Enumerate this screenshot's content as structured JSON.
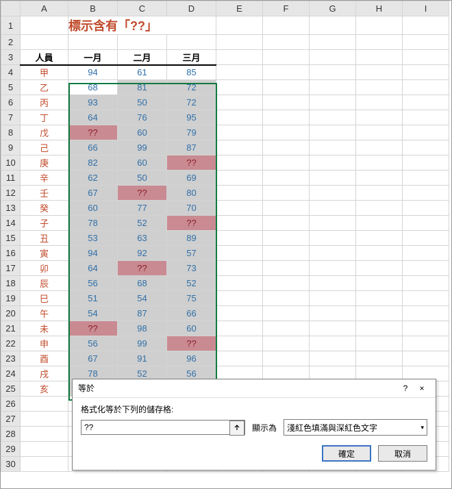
{
  "title": "標示含有「??」",
  "columns": [
    "A",
    "B",
    "C",
    "D",
    "E",
    "F",
    "G",
    "H",
    "I"
  ],
  "headers": {
    "person": "人員",
    "m1": "一月",
    "m2": "二月",
    "m3": "三月"
  },
  "rows": [
    {
      "r": 4,
      "n": "甲",
      "v": [
        "94",
        "61",
        "85"
      ]
    },
    {
      "r": 5,
      "n": "乙",
      "v": [
        "68",
        "81",
        "72"
      ]
    },
    {
      "r": 6,
      "n": "丙",
      "v": [
        "93",
        "50",
        "72"
      ]
    },
    {
      "r": 7,
      "n": "丁",
      "v": [
        "64",
        "76",
        "95"
      ]
    },
    {
      "r": 8,
      "n": "戊",
      "v": [
        "??",
        "60",
        "79"
      ]
    },
    {
      "r": 9,
      "n": "己",
      "v": [
        "66",
        "99",
        "87"
      ]
    },
    {
      "r": 10,
      "n": "庚",
      "v": [
        "82",
        "60",
        "??"
      ]
    },
    {
      "r": 11,
      "n": "辛",
      "v": [
        "62",
        "50",
        "69"
      ]
    },
    {
      "r": 12,
      "n": "壬",
      "v": [
        "67",
        "??",
        "80"
      ]
    },
    {
      "r": 13,
      "n": "癸",
      "v": [
        "60",
        "77",
        "70"
      ]
    },
    {
      "r": 14,
      "n": "子",
      "v": [
        "78",
        "52",
        "??"
      ]
    },
    {
      "r": 15,
      "n": "丑",
      "v": [
        "53",
        "63",
        "89"
      ]
    },
    {
      "r": 16,
      "n": "寅",
      "v": [
        "94",
        "92",
        "57"
      ]
    },
    {
      "r": 17,
      "n": "卯",
      "v": [
        "64",
        "??",
        "73"
      ]
    },
    {
      "r": 18,
      "n": "辰",
      "v": [
        "56",
        "68",
        "52"
      ]
    },
    {
      "r": 19,
      "n": "巳",
      "v": [
        "51",
        "54",
        "75"
      ]
    },
    {
      "r": 20,
      "n": "午",
      "v": [
        "54",
        "87",
        "66"
      ]
    },
    {
      "r": 21,
      "n": "未",
      "v": [
        "??",
        "98",
        "60"
      ]
    },
    {
      "r": 22,
      "n": "申",
      "v": [
        "56",
        "99",
        "??"
      ]
    },
    {
      "r": 23,
      "n": "酉",
      "v": [
        "67",
        "91",
        "96"
      ]
    },
    {
      "r": 24,
      "n": "戌",
      "v": [
        "78",
        "52",
        "56"
      ]
    },
    {
      "r": 25,
      "n": "亥",
      "v": [
        "",
        "",
        ""
      ]
    }
  ],
  "emptyRows": [
    26,
    27,
    28,
    29,
    30
  ],
  "dialog": {
    "title": "等於",
    "label": "格式化等於下列的儲存格:",
    "input_value": "??",
    "show_as": "顯示為",
    "format_option": "淺紅色填滿與深紅色文字",
    "ok": "確定",
    "cancel": "取消",
    "help": "?",
    "close": "×"
  },
  "selection": {
    "fromRow": 5,
    "toRow": 25,
    "fromCol": "B",
    "toCol": "D"
  }
}
